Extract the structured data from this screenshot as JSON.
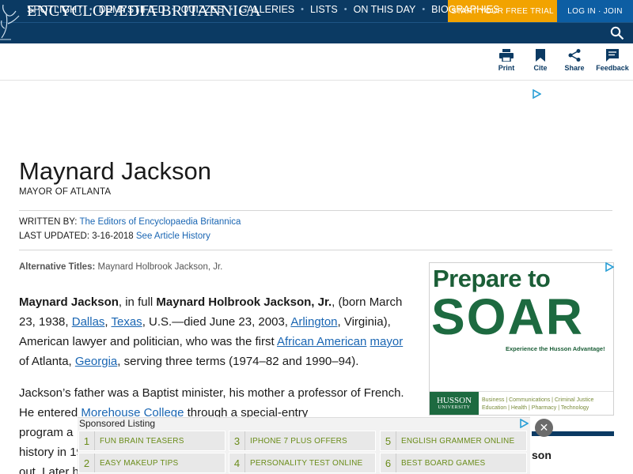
{
  "header": {
    "brand": "ENCYCLOPÆDIA BRITANNICA",
    "trial_label": "START YOUR FREE TRIAL",
    "login_label": "LOG IN · JOIN",
    "nav": [
      "SPOTLIGHT",
      "DEMYSTIFIED",
      "QUIZZES",
      "GALLERIES",
      "LISTS",
      "ON THIS DAY",
      "BIOGRAPHIES"
    ]
  },
  "toolbar": {
    "print": "Print",
    "cite": "Cite",
    "share": "Share",
    "feedback": "Feedback"
  },
  "article": {
    "title": "Maynard Jackson",
    "subtitle": "MAYOR OF ATLANTA",
    "written_by_label": "WRITTEN BY:",
    "written_by": "The Editors of Encyclopaedia Britannica",
    "last_updated_label": "LAST UPDATED:",
    "last_updated": "3-16-2018",
    "history_link": "See Article History",
    "alt_titles_label": "Alternative Titles:",
    "alt_titles": "Maynard Holbrook Jackson, Jr.",
    "p1": {
      "name": "Maynard Jackson",
      "t1": ", in full ",
      "fullname": "Maynard Holbrook Jackson, Jr.",
      "t2": ", (born March 23, 1938, ",
      "dallas": "Dallas",
      "t3": ", ",
      "texas": "Texas",
      "t4": ", U.S.—died June 23, 2003, ",
      "arlington": "Arlington",
      "t5": ", Virginia), American lawyer and politician, who was the first ",
      "aa": "African American",
      "t6": " ",
      "mayor": "mayor",
      "t7": " of Atlanta, ",
      "georgia": "Georgia",
      "t8": ", serving three terms (1974–82 and 1990–94)."
    },
    "p2": {
      "t1": "Jackson’s father was a Baptist minister, his mother a professor of French. He entered ",
      "morehouse": "Morehouse College",
      "t2": " through a special-entry",
      "l3": "program a",
      "l4": "history in 19",
      "l5": "out. Later h"
    }
  },
  "right_ad": {
    "headline": "Prepare to",
    "big": "SOAR",
    "tagline": "Experience the Husson Advantage!",
    "logo": "HUSSON",
    "logo_sub": "UNIVERSITY",
    "line1": "Business | Communications | Criminal Justice",
    "line2": "Education | Health | Pharmacy | Technology"
  },
  "sponsored": {
    "title": "Sponsored Listing",
    "items": [
      {
        "n": "1",
        "label": "FUN BRAIN TEASERS"
      },
      {
        "n": "3",
        "label": "IPHONE 7 PLUS OFFERS"
      },
      {
        "n": "5",
        "label": "ENGLISH GRAMMER ONLINE"
      },
      {
        "n": "2",
        "label": "EASY MAKEUP TIPS"
      },
      {
        "n": "4",
        "label": "PERSONALITY TEST ONLINE"
      },
      {
        "n": "6",
        "label": "BEST BOARD GAMES"
      }
    ],
    "close": "✕"
  },
  "peek_text": "son",
  "colors": {
    "header_bg": "#0b3a63",
    "trial_bg": "#f2a300",
    "link": "#1a66b3",
    "ad_green": "#1d6a40"
  }
}
